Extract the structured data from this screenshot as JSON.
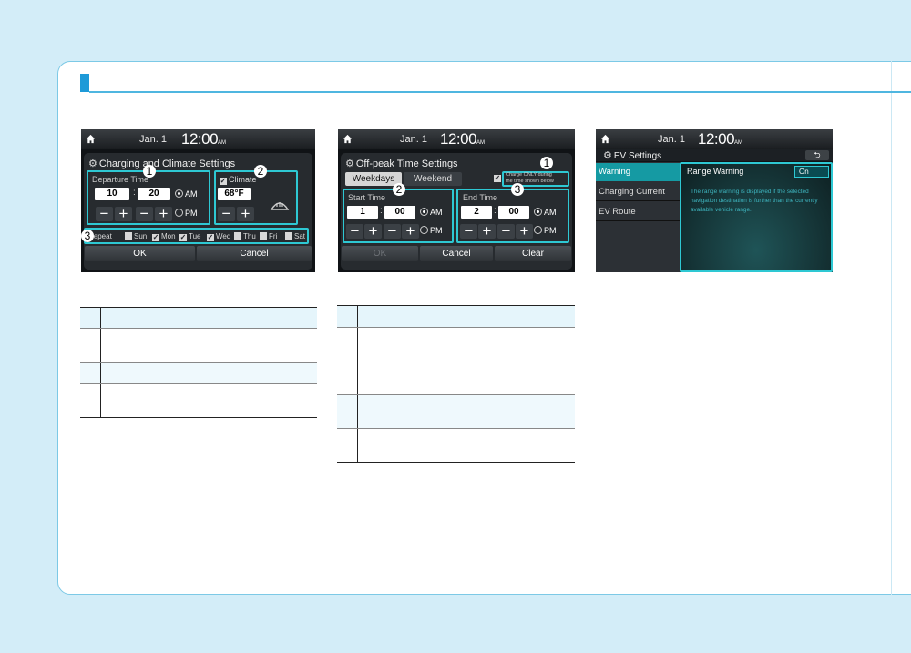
{
  "status": {
    "date": "Jan.  1",
    "time": "12:00",
    "ampm": "AM"
  },
  "screen1": {
    "title": "Charging and Climate Settings",
    "departure_label": "Departure Time",
    "hour": "10",
    "minute": "20",
    "am": "AM",
    "pm": "PM",
    "climate_label": "Climate",
    "temp": "68°F",
    "repeat_label": "Repeat",
    "days": [
      "Sun",
      "Mon",
      "Tue",
      "Wed",
      "Thu",
      "Fri",
      "Sat"
    ],
    "ok": "OK",
    "cancel": "Cancel"
  },
  "screen2": {
    "title": "Off-peak Time Settings",
    "tab_weekdays": "Weekdays",
    "tab_weekend": "Weekend",
    "charge_only_line1": "Charge ONLY during",
    "charge_only_line2": "the time shown below",
    "start_label": "Start Time",
    "end_label": "End Time",
    "start_hour": "1",
    "start_min": "00",
    "end_hour": "2",
    "end_min": "00",
    "am": "AM",
    "pm": "PM",
    "ok": "OK",
    "cancel": "Cancel",
    "clear": "Clear"
  },
  "screen3": {
    "title": "EV Settings",
    "menu": [
      "Warning",
      "Charging Current",
      "EV Route"
    ],
    "range_label": "Range Warning",
    "on": "On",
    "description": "The range warning is displayed if the selected navigation destination is further than the currently available vehicle range."
  },
  "callouts": {
    "one": "1",
    "two": "2",
    "three": "3"
  },
  "colors": {
    "accent": "#2ec8d3",
    "header": "#1e9ad8",
    "page_bg": "#d3edf8"
  }
}
